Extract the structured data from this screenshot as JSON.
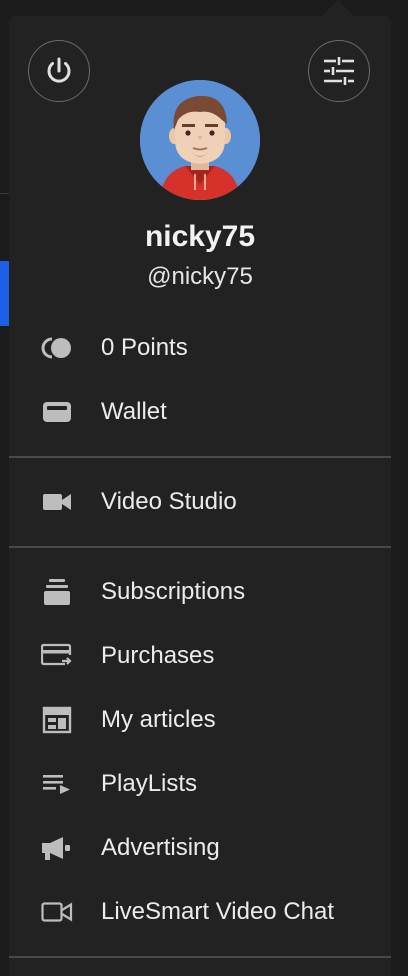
{
  "profile": {
    "username": "nicky75",
    "handle": "@nicky75"
  },
  "header_buttons": {
    "power_icon": "power-icon",
    "settings_icon": "sliders-icon"
  },
  "menu": {
    "section1": [
      {
        "label": "0 Points",
        "icon": "points-icon"
      },
      {
        "label": "Wallet",
        "icon": "wallet-icon"
      }
    ],
    "section2": [
      {
        "label": "Video Studio",
        "icon": "video-camera-icon"
      }
    ],
    "section3": [
      {
        "label": "Subscriptions",
        "icon": "subscriptions-icon"
      },
      {
        "label": "Purchases",
        "icon": "purchases-icon"
      },
      {
        "label": "My articles",
        "icon": "articles-icon"
      },
      {
        "label": "PlayLists",
        "icon": "playlist-icon"
      },
      {
        "label": "Advertising",
        "icon": "megaphone-icon"
      },
      {
        "label": "LiveSmart Video Chat",
        "icon": "video-chat-icon"
      }
    ]
  },
  "colors": {
    "panel_bg": "#222222",
    "text": "#ececec",
    "icon": "#bdbdbd",
    "divider": "#4a4a4a",
    "background_accent": "#1d5fe6"
  }
}
